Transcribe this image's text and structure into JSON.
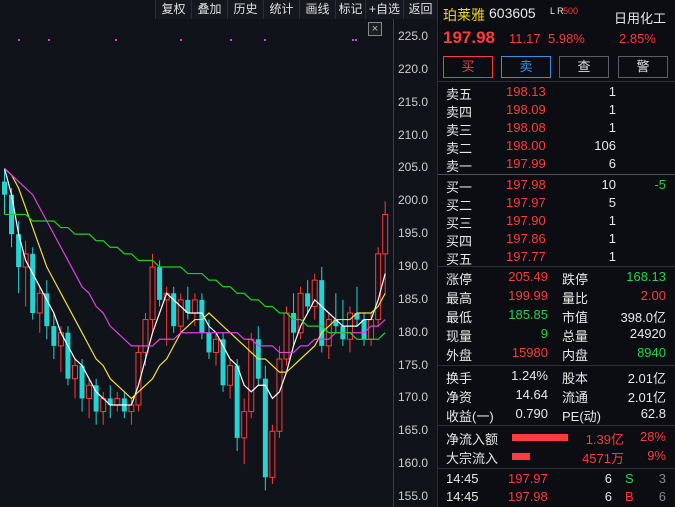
{
  "toolbar": [
    "复权",
    "叠加",
    "历史",
    "统计",
    "画线",
    "标记",
    "+自选",
    "返回"
  ],
  "close_glyph": "×",
  "colors": {
    "up": "#ff3b3b",
    "down": "#22d4d4",
    "ma5": "#ffffff",
    "ma10": "#f0e040",
    "ma20": "#e040e0",
    "ma60": "#20d020"
  },
  "chart": {
    "price_ticks": [
      "225.0",
      "220.0",
      "215.0",
      "210.0",
      "205.0",
      "200.0",
      "195.0",
      "190.0",
      "185.0",
      "180.0",
      "175.0",
      "170.0",
      "165.0",
      "160.0",
      "155.0"
    ],
    "candles": [
      [
        203,
        205,
        198,
        201
      ],
      [
        201,
        202,
        193,
        195
      ],
      [
        195,
        197,
        186,
        190
      ],
      [
        190,
        194,
        184,
        192
      ],
      [
        192,
        193,
        182,
        183
      ],
      [
        183,
        187,
        180,
        186
      ],
      [
        186,
        188,
        179,
        181
      ],
      [
        181,
        183,
        176,
        178
      ],
      [
        178,
        181,
        174,
        180
      ],
      [
        180,
        181,
        172,
        173
      ],
      [
        173,
        176,
        170,
        175
      ],
      [
        175,
        176,
        168,
        170
      ],
      [
        170,
        173,
        167,
        172
      ],
      [
        172,
        173,
        166,
        168
      ],
      [
        168,
        171,
        166,
        170
      ],
      [
        170,
        172,
        167,
        169
      ],
      [
        169,
        171,
        168,
        170
      ],
      [
        170,
        171,
        167,
        168
      ],
      [
        168,
        170,
        166,
        169
      ],
      [
        169,
        178,
        168,
        177
      ],
      [
        177,
        183,
        175,
        182
      ],
      [
        182,
        192,
        180,
        190
      ],
      [
        190,
        191,
        184,
        185
      ],
      [
        185,
        187,
        178,
        186
      ],
      [
        186,
        187,
        180,
        181
      ],
      [
        181,
        186,
        180,
        185
      ],
      [
        185,
        187,
        182,
        183
      ],
      [
        183,
        186,
        181,
        185
      ],
      [
        185,
        186,
        179,
        180
      ],
      [
        180,
        182,
        176,
        177
      ],
      [
        177,
        180,
        175,
        179
      ],
      [
        179,
        180,
        171,
        172
      ],
      [
        172,
        176,
        170,
        175
      ],
      [
        175,
        176,
        162,
        164
      ],
      [
        164,
        170,
        160,
        168
      ],
      [
        168,
        180,
        167,
        179
      ],
      [
        179,
        181,
        172,
        173
      ],
      [
        173,
        175,
        156,
        158
      ],
      [
        158,
        166,
        157,
        165
      ],
      [
        165,
        178,
        164,
        176
      ],
      [
        176,
        184,
        175,
        183
      ],
      [
        183,
        186,
        178,
        180
      ],
      [
        180,
        187,
        179,
        186
      ],
      [
        186,
        188,
        183,
        184
      ],
      [
        184,
        189,
        182,
        188
      ],
      [
        188,
        190,
        177,
        178
      ],
      [
        178,
        183,
        176,
        182
      ],
      [
        182,
        186,
        180,
        181
      ],
      [
        181,
        185,
        178,
        179
      ],
      [
        179,
        184,
        177,
        183
      ],
      [
        183,
        187,
        181,
        182
      ],
      [
        182,
        183,
        178,
        179
      ],
      [
        179,
        183,
        178,
        182
      ],
      [
        182,
        193,
        181,
        192
      ],
      [
        192,
        200,
        186,
        198
      ]
    ],
    "ma": {
      "ma5": [
        205,
        201,
        195,
        191,
        189,
        187,
        185,
        183,
        180,
        178,
        176,
        175,
        173,
        171,
        170,
        169,
        169,
        169,
        169,
        172,
        176,
        180,
        183,
        186,
        185,
        184,
        183,
        183,
        183,
        181,
        180,
        178,
        176,
        175,
        172,
        171,
        172,
        172,
        170,
        171,
        174,
        178,
        181,
        183,
        185,
        184,
        183,
        182,
        181,
        181,
        181,
        182,
        182,
        185,
        189
      ],
      "ma10": [
        205,
        204,
        202,
        199,
        196,
        193,
        190,
        188,
        186,
        184,
        182,
        180,
        178,
        176,
        175,
        173,
        172,
        171,
        170,
        171,
        172,
        173,
        175,
        176,
        178,
        180,
        181,
        182,
        182,
        183,
        182,
        181,
        180,
        179,
        178,
        177,
        176,
        176,
        175,
        174,
        174,
        175,
        176,
        177,
        178,
        180,
        181,
        182,
        182,
        182,
        183,
        183,
        183,
        184,
        186
      ],
      "ma20": [
        205,
        204,
        203,
        202,
        201,
        199,
        197,
        195,
        193,
        191,
        189,
        187,
        186,
        184,
        183,
        181,
        180,
        179,
        178,
        178,
        178,
        178,
        179,
        179,
        179,
        180,
        180,
        180,
        180,
        180,
        180,
        180,
        180,
        180,
        179,
        179,
        178,
        178,
        178,
        177,
        177,
        177,
        178,
        178,
        179,
        179,
        179,
        180,
        180,
        180,
        180,
        180,
        181,
        181,
        182
      ],
      "ma60": [
        198,
        198,
        198,
        198,
        197,
        197,
        197,
        197,
        196,
        196,
        195,
        195,
        195,
        194,
        194,
        193,
        193,
        192,
        192,
        191,
        191,
        191,
        190,
        190,
        190,
        190,
        189,
        189,
        189,
        188,
        188,
        187,
        187,
        186,
        186,
        185,
        185,
        184,
        184,
        183,
        183,
        182,
        182,
        181,
        181,
        181,
        180,
        180,
        180,
        180,
        179,
        179,
        179,
        179,
        180
      ]
    }
  },
  "header": {
    "name": "珀莱雅",
    "code": "603605",
    "tags": "L R",
    "rank": "500",
    "industry": "日用化工",
    "price": "197.98",
    "change": "11.17",
    "pct": "5.98%",
    "industry_pct": "2.85%"
  },
  "trade_buttons": [
    "买",
    "卖",
    "查",
    "警"
  ],
  "asks": [
    {
      "label": "卖五",
      "price": "198.13",
      "vol": "1"
    },
    {
      "label": "卖四",
      "price": "198.09",
      "vol": "1"
    },
    {
      "label": "卖三",
      "price": "198.08",
      "vol": "1"
    },
    {
      "label": "卖二",
      "price": "198.00",
      "vol": "106"
    },
    {
      "label": "卖一",
      "price": "197.99",
      "vol": "6"
    }
  ],
  "bids": [
    {
      "label": "买一",
      "price": "197.98",
      "vol": "10",
      "chg": "-5"
    },
    {
      "label": "买二",
      "price": "197.97",
      "vol": "5",
      "chg": ""
    },
    {
      "label": "买三",
      "price": "197.90",
      "vol": "1",
      "chg": ""
    },
    {
      "label": "买四",
      "price": "197.86",
      "vol": "1",
      "chg": ""
    },
    {
      "label": "买五",
      "price": "197.77",
      "vol": "1",
      "chg": ""
    }
  ],
  "stats1": [
    {
      "l1": "涨停",
      "v1": "205.49",
      "c1": "red",
      "l2": "跌停",
      "v2": "168.13",
      "c2": "green"
    },
    {
      "l1": "最高",
      "v1": "199.99",
      "c1": "red",
      "l2": "量比",
      "v2": "2.00",
      "c2": "red"
    },
    {
      "l1": "最低",
      "v1": "185.85",
      "c1": "green",
      "l2": "市值",
      "v2": "398.0亿",
      "c2": "white"
    },
    {
      "l1": "现量",
      "v1": "9",
      "c1": "green",
      "l2": "总量",
      "v2": "24920",
      "c2": "white"
    },
    {
      "l1": "外盘",
      "v1": "15980",
      "c1": "red",
      "l2": "内盘",
      "v2": "8940",
      "c2": "green"
    }
  ],
  "stats2": [
    {
      "l1": "换手",
      "v1": "1.24%",
      "l2": "股本",
      "v2": "2.01亿"
    },
    {
      "l1": "净资",
      "v1": "14.64",
      "l2": "流通",
      "v2": "2.01亿"
    },
    {
      "l1": "收益(一)",
      "v1": "0.790",
      "l2": "PE(动)",
      "v2": "62.8"
    }
  ],
  "flows": [
    {
      "label": "净流入额",
      "value": "1.39亿",
      "pct": "28%",
      "fill": 0.28
    },
    {
      "label": "大宗流入",
      "value": "4571万",
      "pct": "9%",
      "fill": 0.09
    }
  ],
  "ticks": [
    {
      "time": "14:45",
      "price": "197.97",
      "vol": "6",
      "side": "S",
      "count": "3"
    },
    {
      "time": "14:45",
      "price": "197.98",
      "vol": "6",
      "side": "B",
      "count": "6"
    }
  ]
}
